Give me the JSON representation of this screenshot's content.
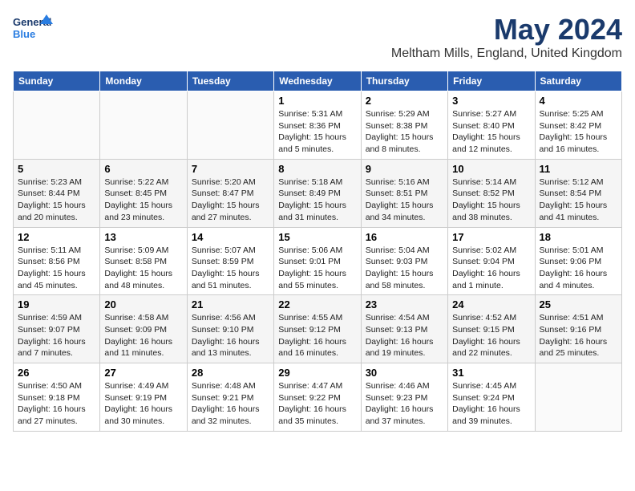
{
  "logo": {
    "line1": "General",
    "line2": "Blue"
  },
  "title": "May 2024",
  "location": "Meltham Mills, England, United Kingdom",
  "days_of_week": [
    "Sunday",
    "Monday",
    "Tuesday",
    "Wednesday",
    "Thursday",
    "Friday",
    "Saturday"
  ],
  "weeks": [
    [
      {
        "num": "",
        "info": ""
      },
      {
        "num": "",
        "info": ""
      },
      {
        "num": "",
        "info": ""
      },
      {
        "num": "1",
        "info": "Sunrise: 5:31 AM\nSunset: 8:36 PM\nDaylight: 15 hours\nand 5 minutes."
      },
      {
        "num": "2",
        "info": "Sunrise: 5:29 AM\nSunset: 8:38 PM\nDaylight: 15 hours\nand 8 minutes."
      },
      {
        "num": "3",
        "info": "Sunrise: 5:27 AM\nSunset: 8:40 PM\nDaylight: 15 hours\nand 12 minutes."
      },
      {
        "num": "4",
        "info": "Sunrise: 5:25 AM\nSunset: 8:42 PM\nDaylight: 15 hours\nand 16 minutes."
      }
    ],
    [
      {
        "num": "5",
        "info": "Sunrise: 5:23 AM\nSunset: 8:44 PM\nDaylight: 15 hours\nand 20 minutes."
      },
      {
        "num": "6",
        "info": "Sunrise: 5:22 AM\nSunset: 8:45 PM\nDaylight: 15 hours\nand 23 minutes."
      },
      {
        "num": "7",
        "info": "Sunrise: 5:20 AM\nSunset: 8:47 PM\nDaylight: 15 hours\nand 27 minutes."
      },
      {
        "num": "8",
        "info": "Sunrise: 5:18 AM\nSunset: 8:49 PM\nDaylight: 15 hours\nand 31 minutes."
      },
      {
        "num": "9",
        "info": "Sunrise: 5:16 AM\nSunset: 8:51 PM\nDaylight: 15 hours\nand 34 minutes."
      },
      {
        "num": "10",
        "info": "Sunrise: 5:14 AM\nSunset: 8:52 PM\nDaylight: 15 hours\nand 38 minutes."
      },
      {
        "num": "11",
        "info": "Sunrise: 5:12 AM\nSunset: 8:54 PM\nDaylight: 15 hours\nand 41 minutes."
      }
    ],
    [
      {
        "num": "12",
        "info": "Sunrise: 5:11 AM\nSunset: 8:56 PM\nDaylight: 15 hours\nand 45 minutes."
      },
      {
        "num": "13",
        "info": "Sunrise: 5:09 AM\nSunset: 8:58 PM\nDaylight: 15 hours\nand 48 minutes."
      },
      {
        "num": "14",
        "info": "Sunrise: 5:07 AM\nSunset: 8:59 PM\nDaylight: 15 hours\nand 51 minutes."
      },
      {
        "num": "15",
        "info": "Sunrise: 5:06 AM\nSunset: 9:01 PM\nDaylight: 15 hours\nand 55 minutes."
      },
      {
        "num": "16",
        "info": "Sunrise: 5:04 AM\nSunset: 9:03 PM\nDaylight: 15 hours\nand 58 minutes."
      },
      {
        "num": "17",
        "info": "Sunrise: 5:02 AM\nSunset: 9:04 PM\nDaylight: 16 hours\nand 1 minute."
      },
      {
        "num": "18",
        "info": "Sunrise: 5:01 AM\nSunset: 9:06 PM\nDaylight: 16 hours\nand 4 minutes."
      }
    ],
    [
      {
        "num": "19",
        "info": "Sunrise: 4:59 AM\nSunset: 9:07 PM\nDaylight: 16 hours\nand 7 minutes."
      },
      {
        "num": "20",
        "info": "Sunrise: 4:58 AM\nSunset: 9:09 PM\nDaylight: 16 hours\nand 11 minutes."
      },
      {
        "num": "21",
        "info": "Sunrise: 4:56 AM\nSunset: 9:10 PM\nDaylight: 16 hours\nand 13 minutes."
      },
      {
        "num": "22",
        "info": "Sunrise: 4:55 AM\nSunset: 9:12 PM\nDaylight: 16 hours\nand 16 minutes."
      },
      {
        "num": "23",
        "info": "Sunrise: 4:54 AM\nSunset: 9:13 PM\nDaylight: 16 hours\nand 19 minutes."
      },
      {
        "num": "24",
        "info": "Sunrise: 4:52 AM\nSunset: 9:15 PM\nDaylight: 16 hours\nand 22 minutes."
      },
      {
        "num": "25",
        "info": "Sunrise: 4:51 AM\nSunset: 9:16 PM\nDaylight: 16 hours\nand 25 minutes."
      }
    ],
    [
      {
        "num": "26",
        "info": "Sunrise: 4:50 AM\nSunset: 9:18 PM\nDaylight: 16 hours\nand 27 minutes."
      },
      {
        "num": "27",
        "info": "Sunrise: 4:49 AM\nSunset: 9:19 PM\nDaylight: 16 hours\nand 30 minutes."
      },
      {
        "num": "28",
        "info": "Sunrise: 4:48 AM\nSunset: 9:21 PM\nDaylight: 16 hours\nand 32 minutes."
      },
      {
        "num": "29",
        "info": "Sunrise: 4:47 AM\nSunset: 9:22 PM\nDaylight: 16 hours\nand 35 minutes."
      },
      {
        "num": "30",
        "info": "Sunrise: 4:46 AM\nSunset: 9:23 PM\nDaylight: 16 hours\nand 37 minutes."
      },
      {
        "num": "31",
        "info": "Sunrise: 4:45 AM\nSunset: 9:24 PM\nDaylight: 16 hours\nand 39 minutes."
      },
      {
        "num": "",
        "info": ""
      }
    ]
  ]
}
